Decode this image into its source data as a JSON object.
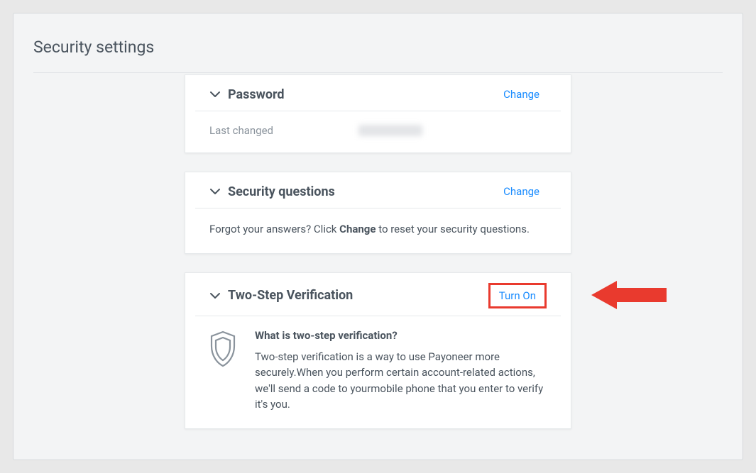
{
  "page": {
    "title": "Security settings"
  },
  "password": {
    "title": "Password",
    "action": "Change",
    "last_changed_label": "Last changed"
  },
  "security_questions": {
    "title": "Security questions",
    "action": "Change",
    "forgot_prefix": "Forgot your answers? Click ",
    "forgot_bold": "Change",
    "forgot_suffix": " to reset your security questions."
  },
  "twostep": {
    "title": "Two-Step Verification",
    "action": "Turn On",
    "heading": "What is two-step verification?",
    "description": "Two-step verification is a way to use Payoneer more securely.When you perform certain account-related actions, we'll send a code to yourmobile phone that you enter to verify it's you."
  }
}
